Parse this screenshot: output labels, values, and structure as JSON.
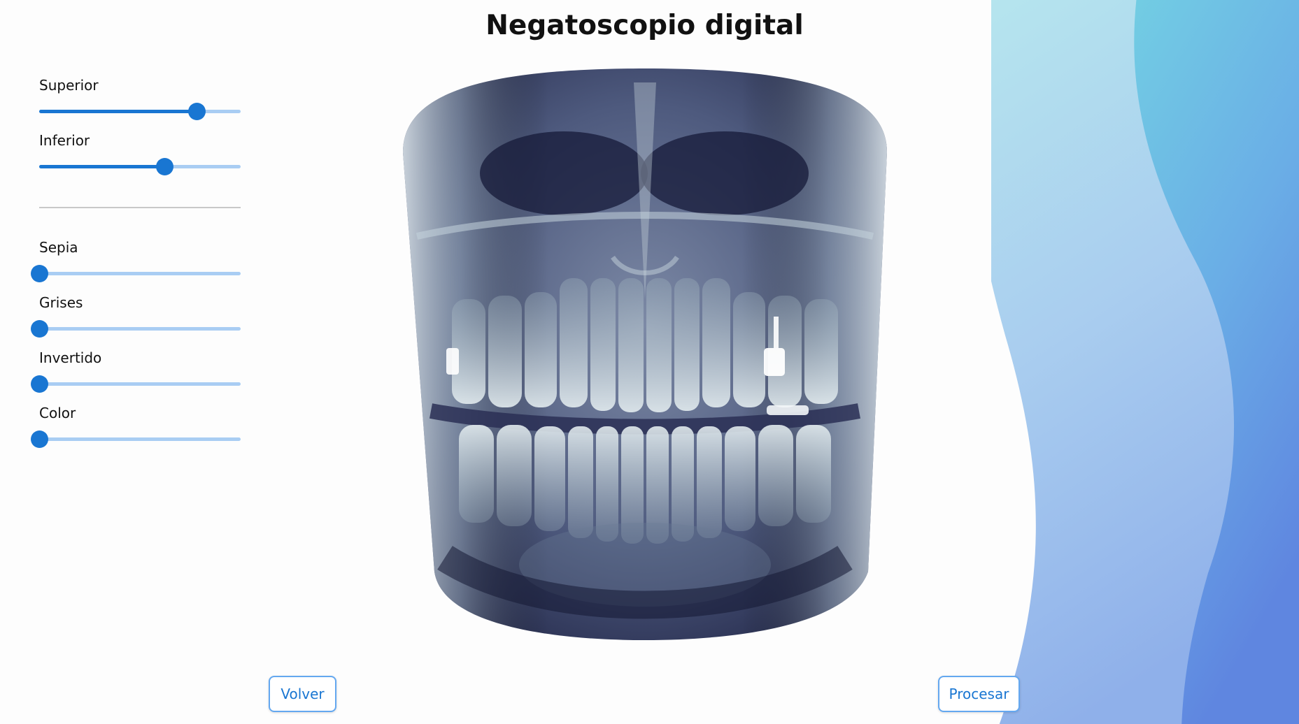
{
  "title": "Negatoscopio digital",
  "controls": {
    "superior": {
      "label": "Superior",
      "value": 0.78
    },
    "inferior": {
      "label": "Inferior",
      "value": 0.62
    },
    "sepia": {
      "label": "Sepia",
      "value": 0
    },
    "grises": {
      "label": "Grises",
      "value": 0
    },
    "invertido": {
      "label": "Invertido",
      "value": 0
    },
    "color": {
      "label": "Color",
      "value": 0
    }
  },
  "buttons": {
    "volver": "Volver",
    "procesar": "Procesar"
  },
  "image": {
    "subject": "panoramic-dental-xray"
  },
  "colors": {
    "accent": "#1976d2",
    "track": "#a9cdf3",
    "button_border": "#64a8f0"
  }
}
